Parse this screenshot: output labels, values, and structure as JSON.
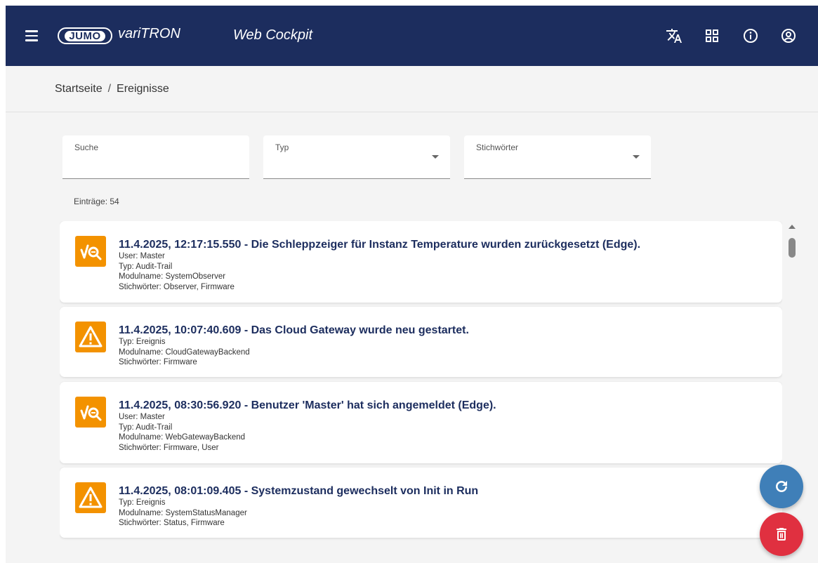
{
  "header": {
    "logo_text": "JUMO",
    "product_name": "variTRON",
    "app_title": "Web Cockpit",
    "icons": [
      "translate-icon",
      "dashboard-icon",
      "info-icon",
      "account-icon",
      "menu-icon"
    ]
  },
  "breadcrumb": {
    "home": "Startseite",
    "separator": "/",
    "current": "Ereignisse"
  },
  "filters": {
    "search_label": "Suche",
    "search_value": "",
    "type_label": "Typ",
    "keywords_label": "Stichwörter"
  },
  "entries": "Einträge: 54",
  "events": [
    {
      "icon": "audit-trail-icon",
      "title": "11.4.2025, 12:17:15.550 - Die Schleppzeiger für Instanz Temperature wurden zurückgesetzt (Edge).",
      "lines": [
        "User: Master",
        "Typ: Audit-Trail",
        "Modulname: SystemObserver",
        "Stichwörter: Observer, Firmware"
      ]
    },
    {
      "icon": "warning-icon",
      "title": "11.4.2025, 10:07:40.609 - Das Cloud Gateway wurde neu gestartet.",
      "lines": [
        "Typ: Ereignis",
        "Modulname: CloudGatewayBackend",
        "Stichwörter: Firmware"
      ]
    },
    {
      "icon": "audit-trail-icon",
      "title": "11.4.2025, 08:30:56.920 - Benutzer 'Master' hat sich angemeldet (Edge).",
      "lines": [
        "User: Master",
        "Typ: Audit-Trail",
        "Modulname: WebGatewayBackend",
        "Stichwörter: Firmware, User"
      ]
    },
    {
      "icon": "warning-icon",
      "title": "11.4.2025, 08:01:09.405 - Systemzustand gewechselt von Init in Run",
      "lines": [
        "Typ: Ereignis",
        "Modulname: SystemStatusManager",
        "Stichwörter: Status, Firmware"
      ]
    }
  ],
  "colors": {
    "header_bg": "#1c2d5e",
    "accent_orange": "#f39200",
    "refresh_fab": "#3f7fb8",
    "delete_fab": "#e03040"
  }
}
